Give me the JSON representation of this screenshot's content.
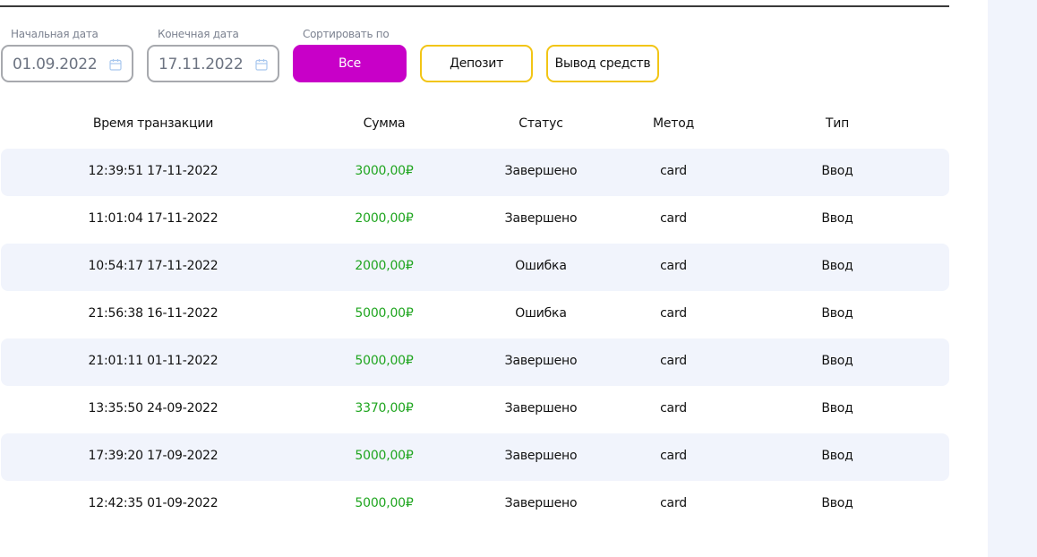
{
  "filters": {
    "start_date_label": "Начальная дата",
    "start_date_value": "01.09.2022",
    "end_date_label": "Конечная дата",
    "end_date_value": "17.11.2022",
    "sort_label": "Сортировать по",
    "sort_options": [
      "Все",
      "Депозит",
      "Вывод средств"
    ],
    "sort_selected": "Все"
  },
  "table": {
    "headers": [
      "Время транзакции",
      "Сумма",
      "Статус",
      "Метод",
      "Тип"
    ],
    "rows": [
      {
        "time": "12:39:51 17-11-2022",
        "amount": "3000,00₽",
        "status": "Завершено",
        "method": "card",
        "type": "Ввод"
      },
      {
        "time": "11:01:04 17-11-2022",
        "amount": "2000,00₽",
        "status": "Завершено",
        "method": "card",
        "type": "Ввод"
      },
      {
        "time": "10:54:17 17-11-2022",
        "amount": "2000,00₽",
        "status": "Ошибка",
        "method": "card",
        "type": "Ввод"
      },
      {
        "time": "21:56:38 16-11-2022",
        "amount": "5000,00₽",
        "status": "Ошибка",
        "method": "card",
        "type": "Ввод"
      },
      {
        "time": "21:01:11 01-11-2022",
        "amount": "5000,00₽",
        "status": "Завершено",
        "method": "card",
        "type": "Ввод"
      },
      {
        "time": "13:35:50 24-09-2022",
        "amount": "3370,00₽",
        "status": "Завершено",
        "method": "card",
        "type": "Ввод"
      },
      {
        "time": "17:39:20 17-09-2022",
        "amount": "5000,00₽",
        "status": "Завершено",
        "method": "card",
        "type": "Ввод"
      },
      {
        "time": "12:42:35 01-09-2022",
        "amount": "5000,00₽",
        "status": "Завершено",
        "method": "card",
        "type": "Ввод"
      }
    ]
  },
  "colors": {
    "accent": "#c800c8",
    "outline": "#f2c515",
    "amount": "#1fa51f",
    "row_shade": "#f1f4fc"
  },
  "icons": {
    "date_picker": "calendar-icon"
  }
}
